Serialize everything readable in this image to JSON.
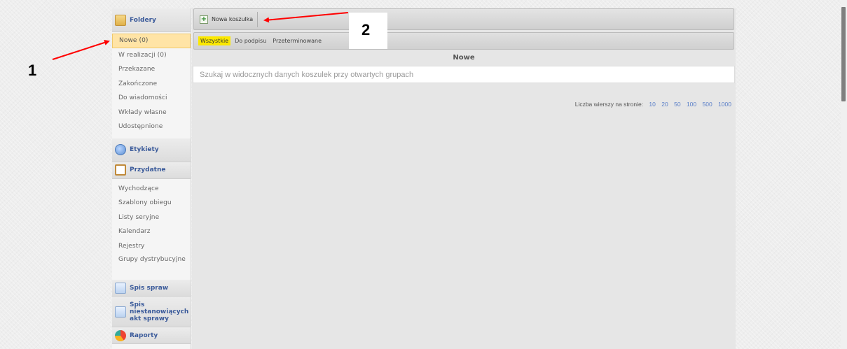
{
  "colors": {
    "accent_blue": "#3a5a9a",
    "active_item_bg": "#ffe4a6",
    "filter_highlight": "#fbe800",
    "annotation_red": "#ff0000"
  },
  "sidebar": {
    "folders_header": {
      "label": "Foldery",
      "icon": "folder-icon"
    },
    "folders": [
      {
        "label": "Nowe (0)",
        "active": true
      },
      {
        "label": "W realizacji (0)"
      },
      {
        "label": "Przekazane"
      },
      {
        "label": "Zakończone"
      },
      {
        "label": "Do wiadomości"
      },
      {
        "label": "Wkłady własne"
      },
      {
        "label": "Udostępnione"
      }
    ],
    "labels_header": {
      "label": "Etykiety",
      "icon": "tag-icon"
    },
    "useful_header": {
      "label": "Przydatne",
      "icon": "clipboard-icon"
    },
    "useful": [
      {
        "label": "Wychodzące"
      },
      {
        "label": "Szablony obiegu"
      },
      {
        "label": "Listy seryjne"
      },
      {
        "label": "Kalendarz"
      },
      {
        "label": "Rejestry"
      },
      {
        "label": "Grupy dystrybucyjne"
      }
    ],
    "cases_header": {
      "label": "Spis spraw",
      "icon": "document-icon"
    },
    "noncase_header": {
      "label": "Spis niestanowiących akt sprawy",
      "icon": "document-icon"
    },
    "reports_header": {
      "label": "Raporty",
      "icon": "chart-icon"
    }
  },
  "toolbar": {
    "new_basket_label": "Nowa koszulka",
    "icon": "add-document-icon"
  },
  "filters": [
    {
      "label": "Wszystkie",
      "active": true
    },
    {
      "label": "Do podpisu"
    },
    {
      "label": "Przeterminowane"
    }
  ],
  "main": {
    "section_title": "Nowe",
    "search_placeholder": "Szukaj w widocznych danych koszulek przy otwartych grupach",
    "rows_label": "Liczba wierszy na stronie:",
    "rows_options": [
      "10",
      "20",
      "50",
      "100",
      "500",
      "1000"
    ]
  },
  "annotations": {
    "callout_1": "1",
    "callout_2": "2"
  }
}
